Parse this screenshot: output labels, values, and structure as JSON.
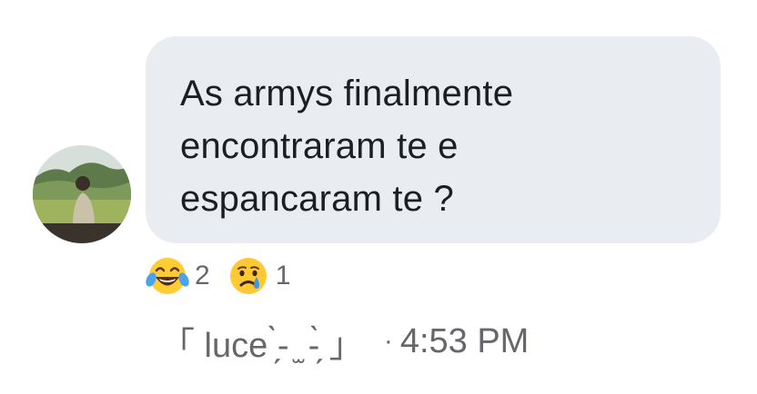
{
  "comment": {
    "author": "「 luce ̗̀- ̫ -̗̀ 」",
    "text": "As armys finalmente encontraram te e espancaram te ?",
    "timestamp": "4:53 PM",
    "separator": "·"
  },
  "reactions": [
    {
      "icon": "laughing-tears-emoji-icon",
      "count": "2"
    },
    {
      "icon": "crying-sad-emoji-icon",
      "count": "1"
    }
  ],
  "colors": {
    "bubble": "#e9edf2",
    "text": "#1c1e21",
    "meta": "#65676b"
  }
}
